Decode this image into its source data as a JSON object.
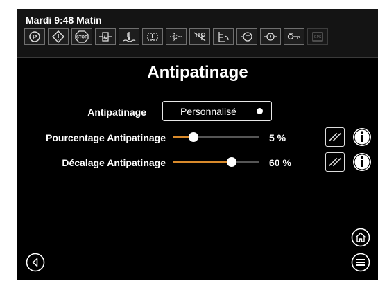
{
  "header": {
    "clock": "Mardi 9:48 Matin",
    "status_icons": [
      {
        "name": "parking-brake-icon",
        "dim": false
      },
      {
        "name": "warning-icon",
        "dim": false
      },
      {
        "name": "stop-icon",
        "dim": false
      },
      {
        "name": "fuel-filter-icon",
        "dim": false
      },
      {
        "name": "coolant-temperature-icon",
        "dim": false
      },
      {
        "name": "transmission-icon",
        "dim": false
      },
      {
        "name": "hydraulic-icon",
        "dim": false
      },
      {
        "name": "traction-control-icon",
        "dim": false
      },
      {
        "name": "fuel-level-icon",
        "dim": false
      },
      {
        "name": "engine-icon",
        "dim": false
      },
      {
        "name": "oil-pressure-icon",
        "dim": false
      },
      {
        "name": "key-icon",
        "dim": false
      },
      {
        "name": "gps-icon",
        "dim": true
      }
    ]
  },
  "page": {
    "title": "Antipatinage"
  },
  "mode": {
    "label": "Antipatinage",
    "value": "Personnalisé"
  },
  "sliders": [
    {
      "label": "Pourcentage Antipatinage",
      "value_text": "5 %",
      "level_percent": 5
    },
    {
      "label": "Décalage Antipatinage",
      "value_text": "60 %",
      "level_percent": 60
    }
  ],
  "colors": {
    "accent": "#d98a2b",
    "background": "#000000"
  },
  "icons": {
    "reset": "reset-icon",
    "info": "info-icon",
    "back": "back-icon",
    "home": "home-icon",
    "menu": "menu-icon"
  }
}
